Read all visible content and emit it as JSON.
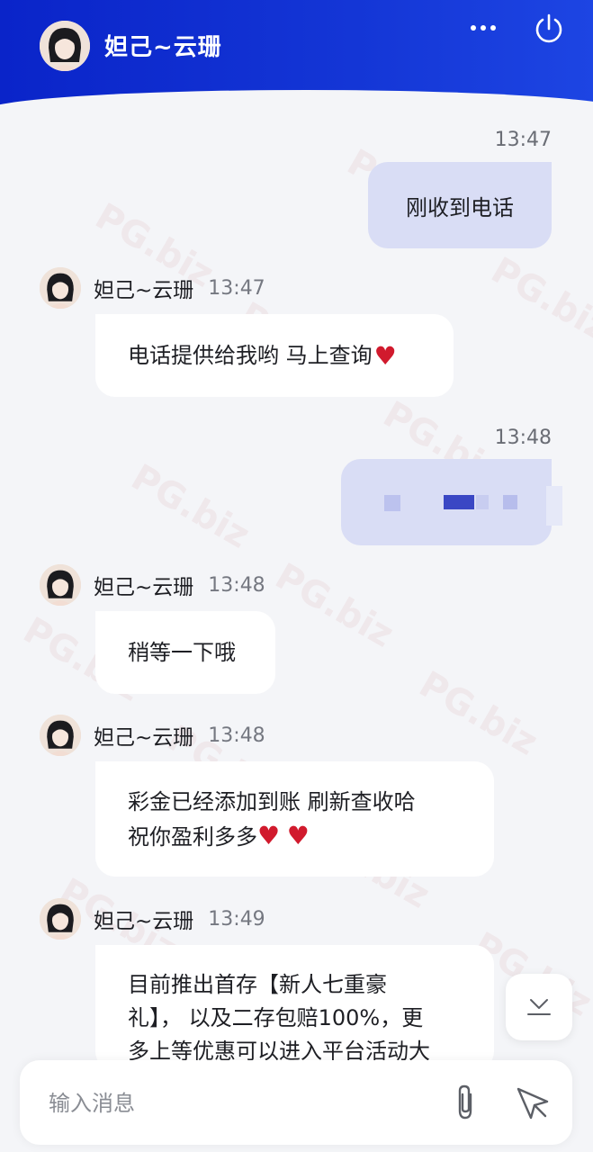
{
  "header": {
    "title": "妲己~云珊",
    "more_icon": "more-horizontal-icon",
    "power_icon": "power-icon",
    "bg_color": "#1436d6"
  },
  "messages": {
    "out1": {
      "time": "13:47",
      "text": "刚收到电话"
    },
    "in1": {
      "name": "妲己~云珊",
      "time": "13:47",
      "text": "电话提供给我哟 马上查询",
      "heart": "♥"
    },
    "out2": {
      "time": "13:48"
    },
    "in2": {
      "name": "妲己~云珊",
      "time": "13:48",
      "text": "稍等一下哦"
    },
    "in3": {
      "name": "妲己~云珊",
      "time": "13:48",
      "line1": "彩金已经添加到账 刷新查收哈",
      "line2": "祝你盈利多多",
      "heart1": "♥",
      "heart2": "♥"
    },
    "in4": {
      "name": "妲己~云珊",
      "time": "13:49",
      "line1": "目前推出首存【新人七重豪",
      "line2": "礼】， 以及二存包赔100%，更",
      "line3": "多上等优惠可以进入平台活动大"
    }
  },
  "composer": {
    "placeholder": "输入消息",
    "attach_icon": "paperclip-icon",
    "send_icon": "send-icon"
  },
  "scroll_down_icon": "scroll-to-bottom-icon",
  "watermark": "PG.biz"
}
